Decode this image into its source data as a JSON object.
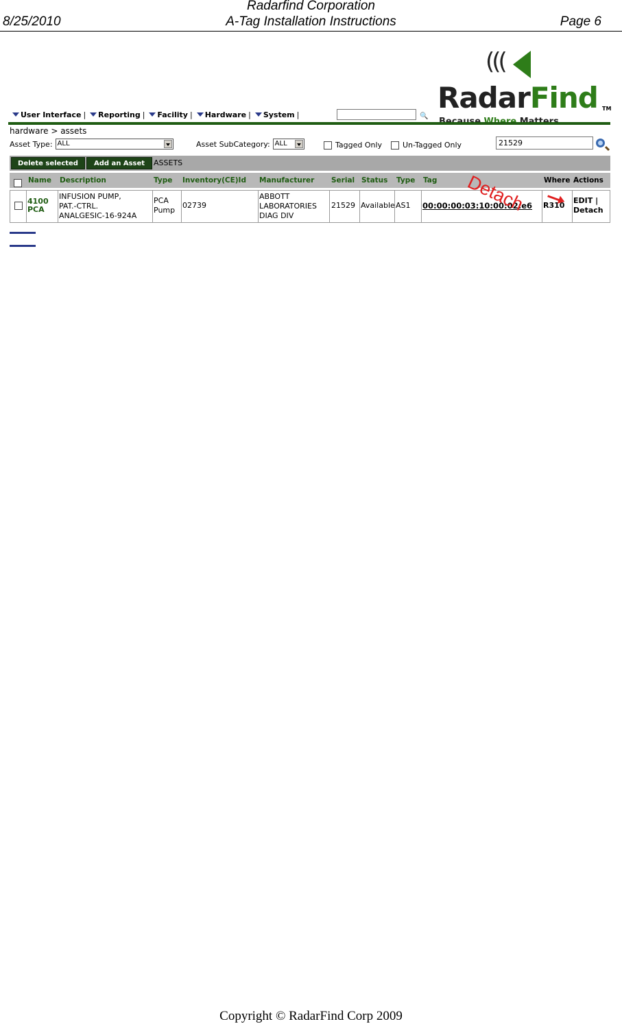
{
  "header": {
    "company": "Radarfind Corporation",
    "date": "8/25/2010",
    "doc_title": "A-Tag Installation Instructions",
    "page": "Page  6"
  },
  "logo": {
    "word_a": "Radar",
    "word_b": "Find",
    "tm": "TM",
    "tag_a": "Because ",
    "tag_b": "Where",
    "tag_c": " Matters",
    "brand_green": "#2e7d19"
  },
  "menu": {
    "items": [
      "User Interface",
      "Reporting",
      "Facility",
      "Hardware",
      "System"
    ],
    "sep": "|"
  },
  "breadcrumb": "hardware > assets",
  "filters": {
    "asset_type_label": "Asset Type:",
    "asset_type_value": "ALL",
    "subcat_label": "Asset SubCategory:",
    "subcat_value": "ALL",
    "tagged_only": "Tagged Only",
    "untagged_only": "Un-Tagged Only",
    "search_value": "21529"
  },
  "actions": {
    "delete_selected": "Delete selected",
    "add_asset": "Add an Asset",
    "section_label": "ASSETS"
  },
  "table": {
    "columns": [
      "Name",
      "Description",
      "Type",
      "Inventory(CE)Id",
      "Manufacturer",
      "Serial",
      "Status",
      "Type",
      "Tag",
      "Where",
      "Actions"
    ],
    "row": {
      "name_1": "4100",
      "name_2": "PCA",
      "desc_1": "INFUSION PUMP,",
      "desc_2": "PAT.-CTRL.",
      "desc_3": "ANALGESIC-16-924A",
      "type_1": "PCA",
      "type_2": "Pump",
      "inventory": "02739",
      "mfr_1": "ABBOTT",
      "mfr_2": "LABORATORIES",
      "mfr_3": "DIAG DIV",
      "serial": "21529",
      "status": "Available",
      "tag_type": "AS1",
      "tag": "00:00:00:03:10:00:02:e6",
      "where": "R310",
      "action_edit": "EDIT |",
      "action_detach": "Detach"
    }
  },
  "annotation": {
    "text": "Detach",
    "color": "#e02020"
  },
  "footer": "Copyright © RadarFind Corp 2009"
}
